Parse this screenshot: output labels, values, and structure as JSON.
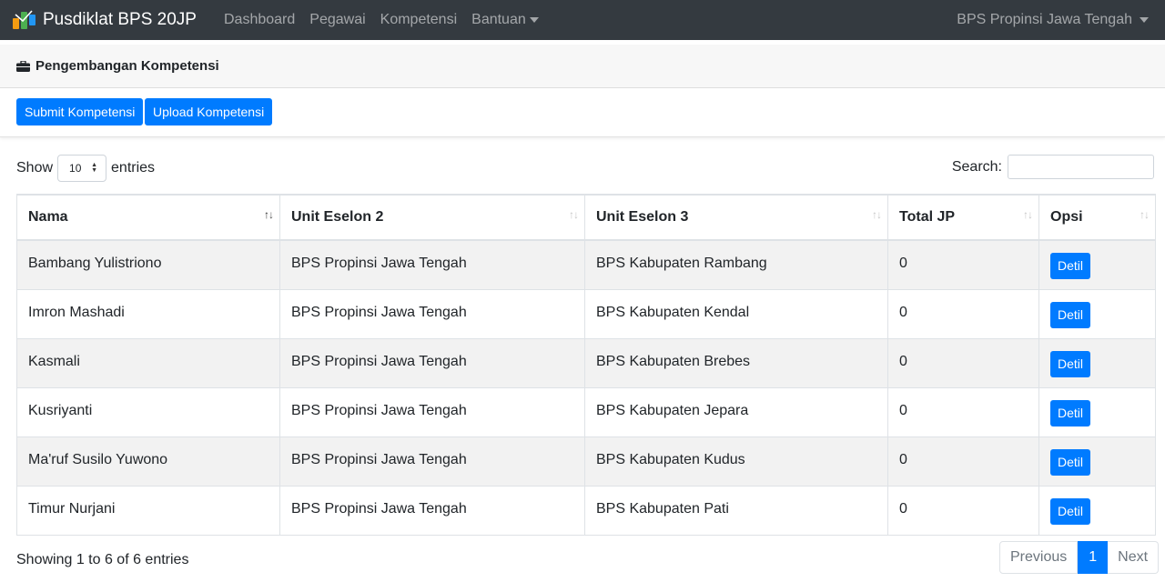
{
  "navbar": {
    "brand": "Pusdiklat BPS 20JP",
    "links": [
      "Dashboard",
      "Pegawai",
      "Kompetensi",
      "Bantuan"
    ],
    "user": "BPS Propinsi Jawa Tengah"
  },
  "header": {
    "icon": "briefcase-icon",
    "title": "Pengembangan Kompetensi"
  },
  "actions": {
    "submit_label": "Submit Kompetensi",
    "upload_label": "Upload Kompetensi"
  },
  "controls": {
    "show_label": "Show",
    "entries_value": "10",
    "entries_label": "entries",
    "search_label": "Search:",
    "search_value": ""
  },
  "table": {
    "columns": [
      "Nama",
      "Unit Eselon 2",
      "Unit Eselon 3",
      "Total JP",
      "Opsi"
    ],
    "rows": [
      {
        "nama": "Bambang Yulistriono",
        "eselon2": "BPS Propinsi Jawa Tengah",
        "eselon3": "BPS Kabupaten Rambang",
        "total": "0",
        "opsi": "Detil"
      },
      {
        "nama": "Imron Mashadi",
        "eselon2": "BPS Propinsi Jawa Tengah",
        "eselon3": "BPS Kabupaten Kendal",
        "total": "0",
        "opsi": "Detil"
      },
      {
        "nama": "Kasmali",
        "eselon2": "BPS Propinsi Jawa Tengah",
        "eselon3": "BPS Kabupaten Brebes",
        "total": "0",
        "opsi": "Detil"
      },
      {
        "nama": "Kusriyanti",
        "eselon2": "BPS Propinsi Jawa Tengah",
        "eselon3": "BPS Kabupaten Jepara",
        "total": "0",
        "opsi": "Detil"
      },
      {
        "nama": "Ma'ruf Susilo Yuwono",
        "eselon2": "BPS Propinsi Jawa Tengah",
        "eselon3": "BPS Kabupaten Kudus",
        "total": "0",
        "opsi": "Detil"
      },
      {
        "nama": "Timur Nurjani",
        "eselon2": "BPS Propinsi Jawa Tengah",
        "eselon3": "BPS Kabupaten Pati",
        "total": "0",
        "opsi": "Detil"
      }
    ]
  },
  "footer": {
    "info": "Showing 1 to 6 of 6 entries",
    "previous": "Previous",
    "current_page": "1",
    "next": "Next"
  },
  "colors": {
    "navbar_bg": "#343a40",
    "primary": "#007bff",
    "header_bg": "#f7f7f7",
    "stripe": "#f2f2f2"
  }
}
